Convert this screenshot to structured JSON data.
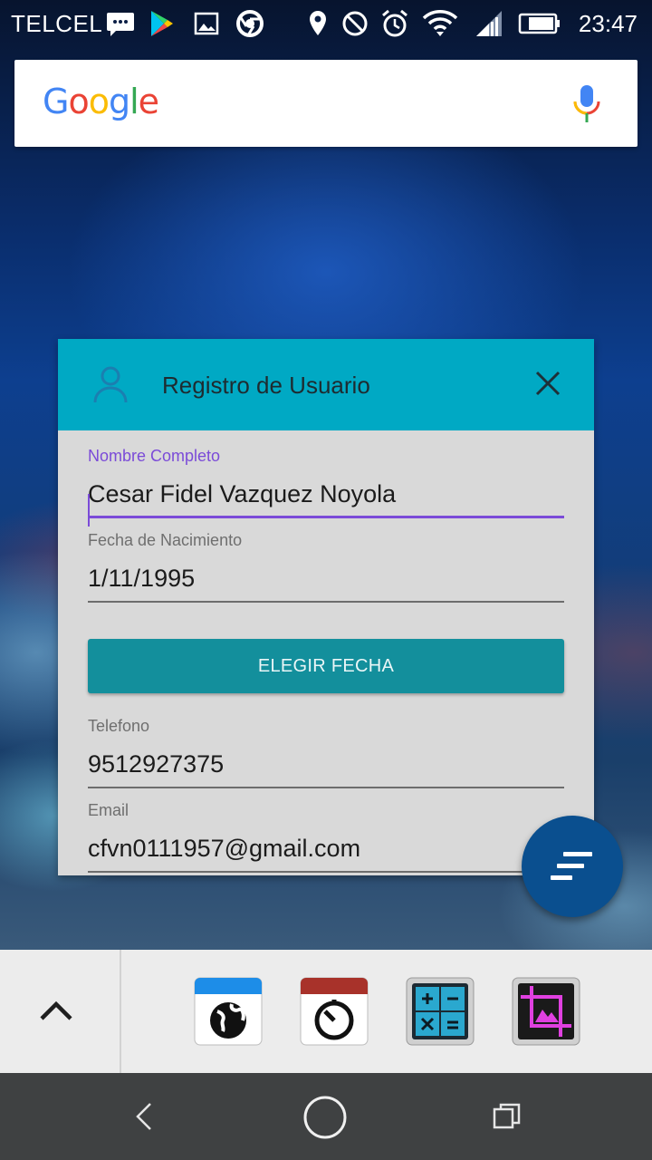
{
  "status_bar": {
    "carrier": "TELCEL",
    "time": "23:47",
    "icons": [
      "sms-icon",
      "play-store-icon",
      "gallery-icon",
      "chrome-icon",
      "location-icon",
      "do-not-disturb-icon",
      "alarm-icon",
      "wifi-icon",
      "signal-icon",
      "battery-icon"
    ]
  },
  "search_bar": {
    "logo_letters": [
      "G",
      "o",
      "o",
      "g",
      "l",
      "e"
    ],
    "mic_icon": "mic-icon"
  },
  "dialog": {
    "title": "Registro de Usuario",
    "header_color": "#00a9c4",
    "fields": {
      "nombre": {
        "label": "Nombre Completo",
        "value": "Cesar Fidel Vazquez Noyola",
        "focused": true
      },
      "fecha": {
        "label": "Fecha de Nacimiento",
        "value": "1/11/1995"
      },
      "telefono": {
        "label": "Telefono",
        "value": "9512927375"
      },
      "email": {
        "label": "Email",
        "value": "cfvn0111957@gmail.com"
      }
    },
    "date_button_label": "ELEGIR FECHA",
    "accent_color": "#7b4bd8"
  },
  "fab": {
    "icon": "sort-lines-icon",
    "color": "#0a4f8f"
  },
  "dock": {
    "expand_icon": "chevron-up-icon",
    "apps": [
      "browser-app-icon",
      "clock-app-icon",
      "calculator-app-icon",
      "photo-editor-app-icon"
    ]
  },
  "nav_bar": {
    "buttons": [
      "back-button",
      "home-button",
      "recents-button"
    ]
  }
}
